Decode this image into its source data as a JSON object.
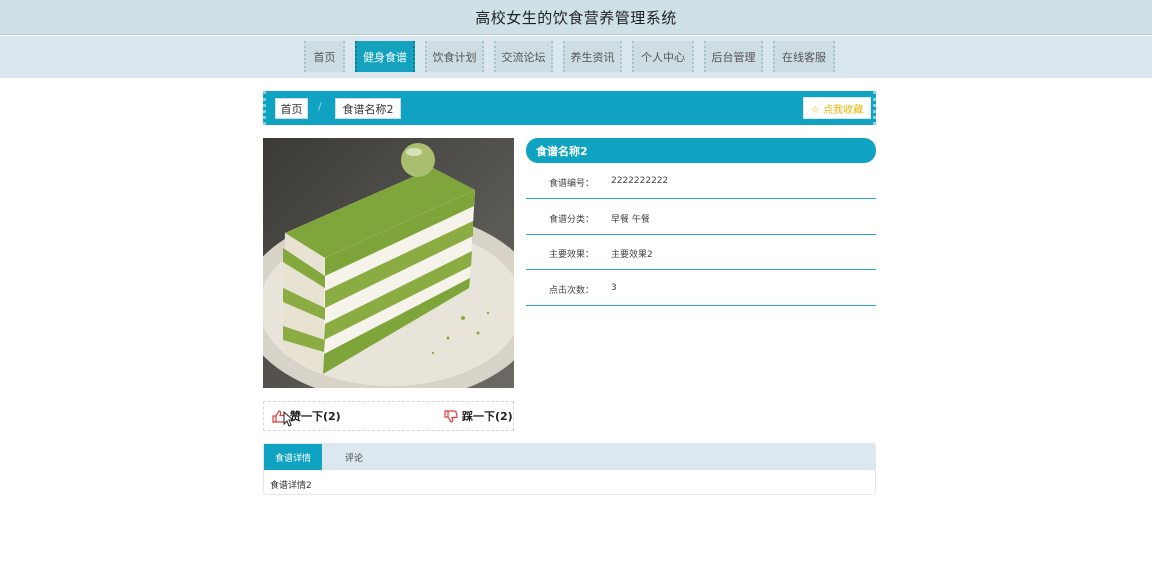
{
  "header": {
    "title": "高校女生的饮食营养管理系统"
  },
  "nav": {
    "items": [
      {
        "label": "首页"
      },
      {
        "label": "健身食谱"
      },
      {
        "label": "饮食计划"
      },
      {
        "label": "交流论坛"
      },
      {
        "label": "养生资讯"
      },
      {
        "label": "个人中心"
      },
      {
        "label": "后台管理"
      },
      {
        "label": "在线客服"
      }
    ],
    "active_index": 1
  },
  "breadcrumb": {
    "home": "首页",
    "current": "食谱名称2",
    "favorite_label": "☆ 点我收藏"
  },
  "votes": {
    "like_label": "赞一下(2)",
    "dislike_label": "踩一下(2)"
  },
  "detail": {
    "title": "食谱名称2",
    "fields": [
      {
        "label": "食谱编号：",
        "value": "2222222222"
      },
      {
        "label": "食谱分类：",
        "value": "早餐 午餐"
      },
      {
        "label": "主要效果：",
        "value": "主要效果2"
      },
      {
        "label": "点击次数：",
        "value": "3"
      }
    ]
  },
  "tabs": {
    "items": [
      {
        "label": "食谱详情"
      },
      {
        "label": "评论"
      }
    ],
    "active_index": 0,
    "content": "食谱详情2"
  },
  "colors": {
    "accent": "#0fa3c1",
    "nav_bg": "#dbe7ee",
    "star": "#f0b400",
    "thumb": "#e53935"
  }
}
